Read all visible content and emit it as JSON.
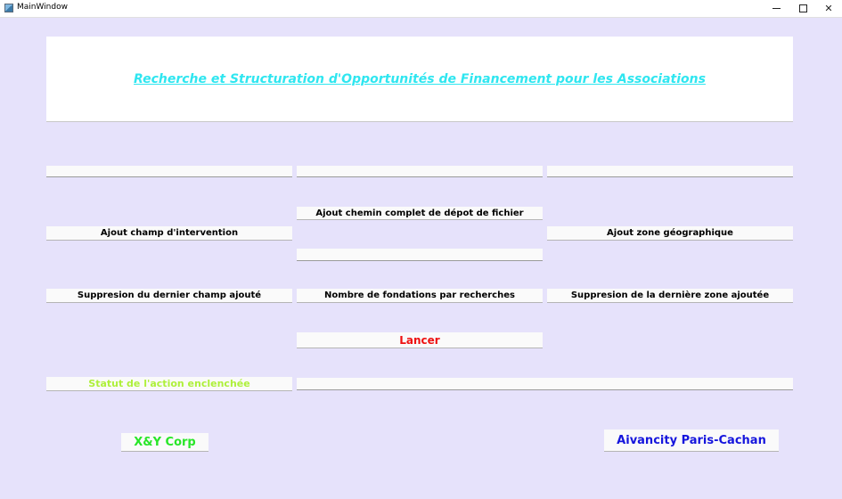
{
  "window": {
    "title": "MainWindow",
    "controls": {
      "minimize": "minimize-icon",
      "maximize": "maximize-icon",
      "close_glyph": "✕"
    }
  },
  "header": {
    "title": "Recherche et Structuration d'Opportunités de Financement pour les Associations"
  },
  "inputs": {
    "field_left": "",
    "field_middle": "",
    "field_right": "",
    "file_path": "",
    "status_value": ""
  },
  "buttons": {
    "add_file_path": "Ajout chemin complet de dépot de fichier",
    "add_intervention_field": "Ajout champ d'intervention",
    "add_geographic_zone": "Ajout zone géographique",
    "remove_last_field": "Suppresion du dernier champ ajouté",
    "foundations_per_search": "Nombre de fondations par recherches",
    "remove_last_zone": "Suppresion de la dernière zone ajoutée",
    "launch": "Lancer"
  },
  "labels": {
    "status": "Statut de l'action enclenchée",
    "company": "X&Y Corp",
    "school": "Aivancity Paris-Cachan"
  },
  "colors": {
    "background": "#e6e2fb",
    "title_color": "#2fe6f0",
    "launch_color": "#ee1111",
    "status_color": "#aef03a",
    "company_color": "#28e628",
    "school_color": "#1515dd"
  }
}
